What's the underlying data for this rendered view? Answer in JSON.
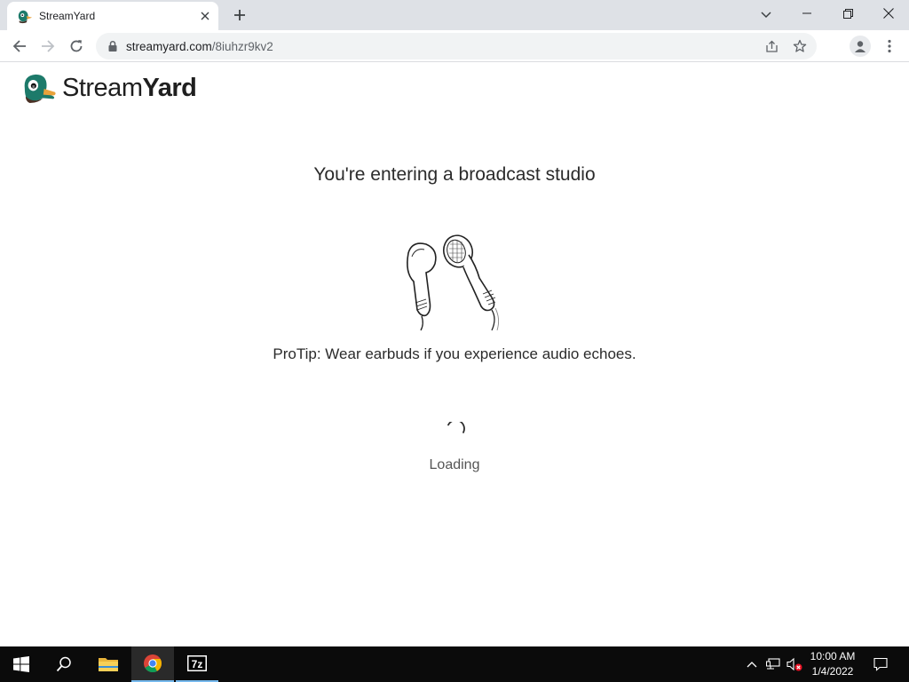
{
  "browser": {
    "tab": {
      "title": "StreamYard",
      "favicon": "streamyard-duck-icon"
    },
    "url": {
      "host": "streamyard.com",
      "path": "/8iuhzr9kv2"
    }
  },
  "page": {
    "logo": {
      "stream": "Stream",
      "yard": "Yard"
    },
    "headline": "You're entering a broadcast studio",
    "illustration": "earbuds-illustration",
    "protip": "ProTip: Wear earbuds if you experience audio echoes.",
    "status": "Loading"
  },
  "taskbar": {
    "time": "10:00 AM",
    "date": "1/4/2022",
    "apps": [
      "start-icon",
      "search-icon",
      "file-explorer-icon",
      "chrome-icon",
      "7zip-icon"
    ],
    "sevenzip_label": "7z"
  },
  "colors": {
    "tab_strip": "#dee1e6",
    "omnibox": "#f1f3f4",
    "duck_green": "#1d7a6a",
    "taskbar": "#0b0b0b"
  }
}
